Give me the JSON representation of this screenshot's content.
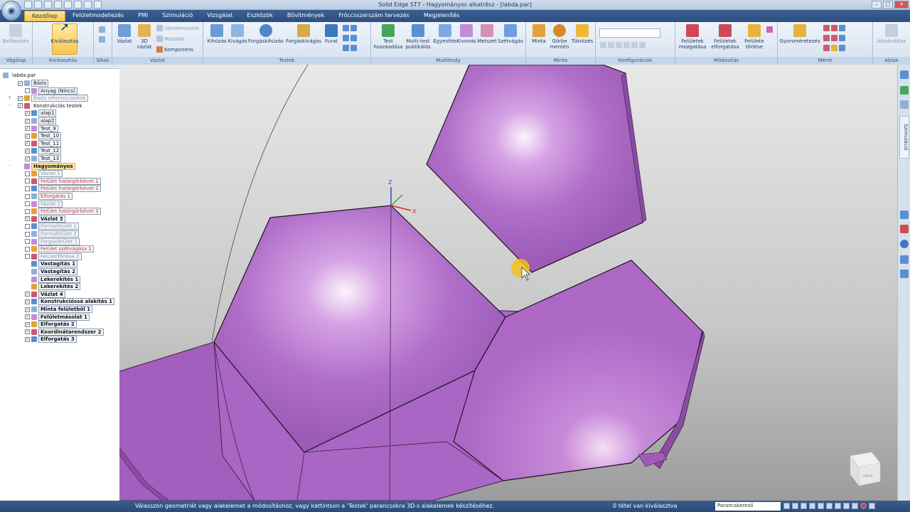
{
  "window": {
    "title": "Solid Edge ST7 - Hagyományos alkatrész - [labda.par]",
    "app_button_glyph": "◉"
  },
  "tabs": [
    {
      "label": "Kezdőlap",
      "active": true
    },
    {
      "label": "Felületmodellezés"
    },
    {
      "label": "PMI"
    },
    {
      "label": "Szimuláció"
    },
    {
      "label": "Vizsgálat"
    },
    {
      "label": "Eszközök"
    },
    {
      "label": "Bővítmények"
    },
    {
      "label": "Fröccsszerszám tervezés"
    },
    {
      "label": "Megjelenítés"
    }
  ],
  "ribbon": {
    "groups": {
      "vagolap": "Vágólap",
      "kivalasztas": "Kiválasztás",
      "sikok": "Síkok",
      "vazlat": "Vázlat",
      "testek": "Testek",
      "multibody": "Multibody",
      "minta": "Minta",
      "konfiguraciok": "Konfigurációk",
      "modositas": "Módosítás",
      "meret": "Méret",
      "ablak": "Ablak"
    },
    "buttons": {
      "beillesztes": "Beillesztés",
      "kivalasztas": "Kiválasztás",
      "vazlat": "Vázlat",
      "vazlat3d": "3D vázlat",
      "vazlatmasolat": "Vázlatmásolat",
      "masolas": "Másolás",
      "komponens": "Komponens",
      "kihuzas": "Kihúzás",
      "kivagas": "Kivágás",
      "forgaskihuzas": "Forgáskihúzás",
      "forgaskivagas": "Forgáskivágás",
      "furat": "Furat",
      "test_hozzaadasa": "Test hozzáadása",
      "multitest": "Multi-test publikálás",
      "egyesites": "Egyesítés",
      "kivonas": "Kivonás",
      "metszet": "Metszet",
      "szetvagas": "Szétvágás",
      "minta": "Minta",
      "gorbe_menten": "Görbe mentén",
      "tukrozes": "Tükrözés",
      "feluletek_mozgatasa": "Felületek mozgatása",
      "feluletek_elforgatasa": "Felületek elforgatása",
      "felulet_torlese": "Felülete törlése",
      "gyorsmeretezes": "Gyorsméretezés",
      "ablakvaltas": "Ablakváltás"
    }
  },
  "tree": {
    "root": "labda.par",
    "items": [
      {
        "label": "Bázis",
        "level": 1,
        "check": true,
        "twisty": "",
        "style": "box"
      },
      {
        "label": "Anyag (Nincs)",
        "level": 2,
        "check": false,
        "style": "box"
      },
      {
        "label": "Bázis referenciasíkok",
        "level": 1,
        "check": true,
        "twisty": "+",
        "style": "box dim"
      },
      {
        "label": "Konstrukciós testek",
        "level": 1,
        "check": true,
        "twisty": "-",
        "style": ""
      },
      {
        "label": "alap1",
        "level": 2,
        "check": true,
        "style": "box"
      },
      {
        "label": "alap2",
        "level": 2,
        "check": true,
        "style": "box"
      },
      {
        "label": "Test_9",
        "level": 2,
        "check": true,
        "style": "box"
      },
      {
        "label": "Test_10",
        "level": 2,
        "check": true,
        "style": "box"
      },
      {
        "label": "Test_11",
        "level": 2,
        "check": true,
        "style": "box"
      },
      {
        "label": "Test_12",
        "level": 2,
        "check": true,
        "style": "box"
      },
      {
        "label": "Test_13",
        "level": 2,
        "check": true,
        "style": "box"
      },
      {
        "label": "Hagyományos",
        "level": 0,
        "check": null,
        "twisty": "-",
        "style": "sel"
      },
      {
        "label": "Vázlat 1",
        "level": 2,
        "check": false,
        "style": "box dim"
      },
      {
        "label": "Felület határgörbével 1",
        "level": 2,
        "check": false,
        "style": "box red"
      },
      {
        "label": "Felület határgörbével 2",
        "level": 2,
        "check": false,
        "style": "box red"
      },
      {
        "label": "Elforgatás 1",
        "level": 2,
        "check": false,
        "style": "box red"
      },
      {
        "label": "Vázlat 2",
        "level": 2,
        "check": false,
        "style": "box dim"
      },
      {
        "label": "Felület határgörbével 3",
        "level": 2,
        "check": false,
        "style": "box red"
      },
      {
        "label": "Vázlat 3",
        "level": 2,
        "check": true,
        "style": "box bold"
      },
      {
        "label": "Formafelület 1",
        "level": 2,
        "check": false,
        "style": "box dim"
      },
      {
        "label": "Formafelület 2",
        "level": 2,
        "check": false,
        "style": "box dim"
      },
      {
        "label": "Forgásfelület 1",
        "level": 2,
        "check": false,
        "style": "box dim"
      },
      {
        "label": "Felület szétvágása 1",
        "level": 2,
        "check": false,
        "style": "box red"
      },
      {
        "label": "FelületTörlése 2",
        "level": 2,
        "check": false,
        "style": "box dim"
      },
      {
        "label": "Vastagítás 1",
        "level": 2,
        "check": null,
        "style": "box bold"
      },
      {
        "label": "Vastagítás 2",
        "level": 2,
        "check": null,
        "style": "box bold"
      },
      {
        "label": "Lekerekítés 1",
        "level": 2,
        "check": null,
        "style": "box bold"
      },
      {
        "label": "Lekerekítés 2",
        "level": 2,
        "check": null,
        "style": "box bold"
      },
      {
        "label": "Vázlat 4",
        "level": 2,
        "check": true,
        "style": "box bold"
      },
      {
        "label": "Konstrukcióssá alakítás 1",
        "level": 2,
        "check": true,
        "style": "box bold"
      },
      {
        "label": "Minta felületből 1",
        "level": 2,
        "check": true,
        "style": "box bold"
      },
      {
        "label": "Felületmásolat 1",
        "level": 2,
        "check": true,
        "style": "box bold"
      },
      {
        "label": "Elforgatás 2",
        "level": 2,
        "check": true,
        "style": "box bold"
      },
      {
        "label": "Koordinátarendszer 2",
        "level": 2,
        "check": true,
        "style": "box bold"
      },
      {
        "label": "Elforgatás 3",
        "level": 2,
        "check": true,
        "style": "box bold"
      }
    ]
  },
  "viewport": {
    "triad": {
      "z": "Z",
      "x": "X"
    },
    "cube_label": "sRGB",
    "model_color": "#b06fc9"
  },
  "rightbar": {
    "tab_label": "Szimuláció"
  },
  "status": {
    "message": "Válasszon geometriát vagy alakelemet a módosításhoz, vagy kattintson a 'Testek' parancsokra 3D-s alakelemek készítéséhez.",
    "selection": "0 tétel van kiválasztva",
    "command_finder": "Parancskereső"
  }
}
